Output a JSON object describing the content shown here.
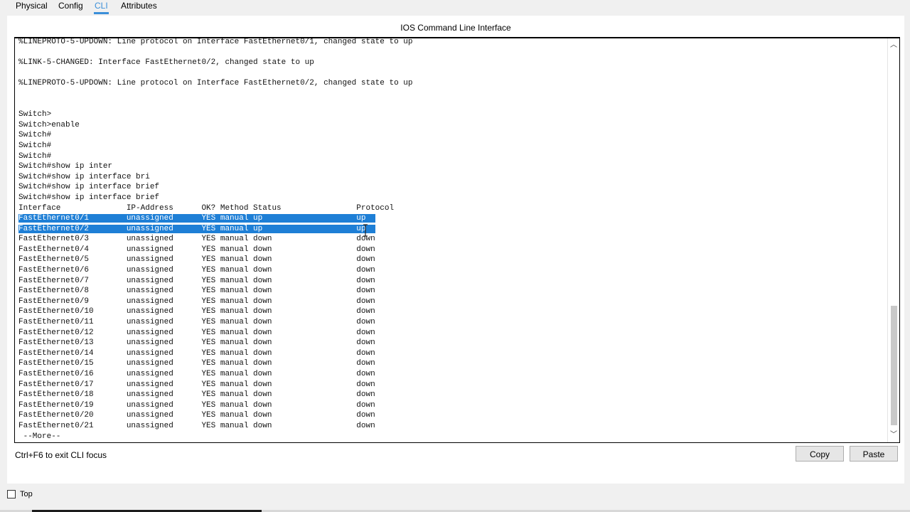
{
  "tabs": [
    {
      "label": "Physical",
      "active": false
    },
    {
      "label": "Config",
      "active": false
    },
    {
      "label": "CLI",
      "active": true
    },
    {
      "label": "Attributes",
      "active": false
    }
  ],
  "cli_title": "IOS Command Line Interface",
  "console": {
    "lines": [
      {
        "text": "%LINEPROTO-5-UPDOWN: Line protocol on Interface FastEthernet0/1, changed state to up",
        "selected": false
      },
      {
        "text": "",
        "selected": false
      },
      {
        "text": "%LINK-5-CHANGED: Interface FastEthernet0/2, changed state to up",
        "selected": false
      },
      {
        "text": "",
        "selected": false
      },
      {
        "text": "%LINEPROTO-5-UPDOWN: Line protocol on Interface FastEthernet0/2, changed state to up",
        "selected": false
      },
      {
        "text": "",
        "selected": false
      },
      {
        "text": "",
        "selected": false
      },
      {
        "text": "Switch>",
        "selected": false
      },
      {
        "text": "Switch>enable",
        "selected": false
      },
      {
        "text": "Switch#",
        "selected": false
      },
      {
        "text": "Switch#",
        "selected": false
      },
      {
        "text": "Switch#",
        "selected": false
      },
      {
        "text": "Switch#show ip inter",
        "selected": false
      },
      {
        "text": "Switch#show ip interface bri",
        "selected": false
      },
      {
        "text": "Switch#show ip interface brief",
        "selected": false
      },
      {
        "text": "Switch#show ip interface brief",
        "selected": false
      },
      {
        "text": "Interface              IP-Address      OK? Method Status                Protocol",
        "selected": false
      },
      {
        "text": "FastEthernet0/1        unassigned      YES manual up                    up  ",
        "selected": true
      },
      {
        "text": "FastEthernet0/2        unassigned      YES manual up                    up  ",
        "selected": true
      },
      {
        "text": "FastEthernet0/3        unassigned      YES manual down                  down",
        "selected": false
      },
      {
        "text": "FastEthernet0/4        unassigned      YES manual down                  down",
        "selected": false
      },
      {
        "text": "FastEthernet0/5        unassigned      YES manual down                  down",
        "selected": false
      },
      {
        "text": "FastEthernet0/6        unassigned      YES manual down                  down",
        "selected": false
      },
      {
        "text": "FastEthernet0/7        unassigned      YES manual down                  down",
        "selected": false
      },
      {
        "text": "FastEthernet0/8        unassigned      YES manual down                  down",
        "selected": false
      },
      {
        "text": "FastEthernet0/9        unassigned      YES manual down                  down",
        "selected": false
      },
      {
        "text": "FastEthernet0/10       unassigned      YES manual down                  down",
        "selected": false
      },
      {
        "text": "FastEthernet0/11       unassigned      YES manual down                  down",
        "selected": false
      },
      {
        "text": "FastEthernet0/12       unassigned      YES manual down                  down",
        "selected": false
      },
      {
        "text": "FastEthernet0/13       unassigned      YES manual down                  down",
        "selected": false
      },
      {
        "text": "FastEthernet0/14       unassigned      YES manual down                  down",
        "selected": false
      },
      {
        "text": "FastEthernet0/15       unassigned      YES manual down                  down",
        "selected": false
      },
      {
        "text": "FastEthernet0/16       unassigned      YES manual down                  down",
        "selected": false
      },
      {
        "text": "FastEthernet0/17       unassigned      YES manual down                  down",
        "selected": false
      },
      {
        "text": "FastEthernet0/18       unassigned      YES manual down                  down",
        "selected": false
      },
      {
        "text": "FastEthernet0/19       unassigned      YES manual down                  down",
        "selected": false
      },
      {
        "text": "FastEthernet0/20       unassigned      YES manual down                  down",
        "selected": false
      },
      {
        "text": "FastEthernet0/21       unassigned      YES manual down                  down",
        "selected": false
      },
      {
        "text": " --More-- ",
        "selected": false
      }
    ],
    "scroll_position": 0.8
  },
  "footer": {
    "hint": "Ctrl+F6 to exit CLI focus",
    "copy_label": "Copy",
    "paste_label": "Paste"
  },
  "bottom": {
    "top_label": "Top",
    "top_checked": false
  },
  "colors": {
    "accent": "#3b8fd9",
    "selection": "#1e7fd6"
  }
}
